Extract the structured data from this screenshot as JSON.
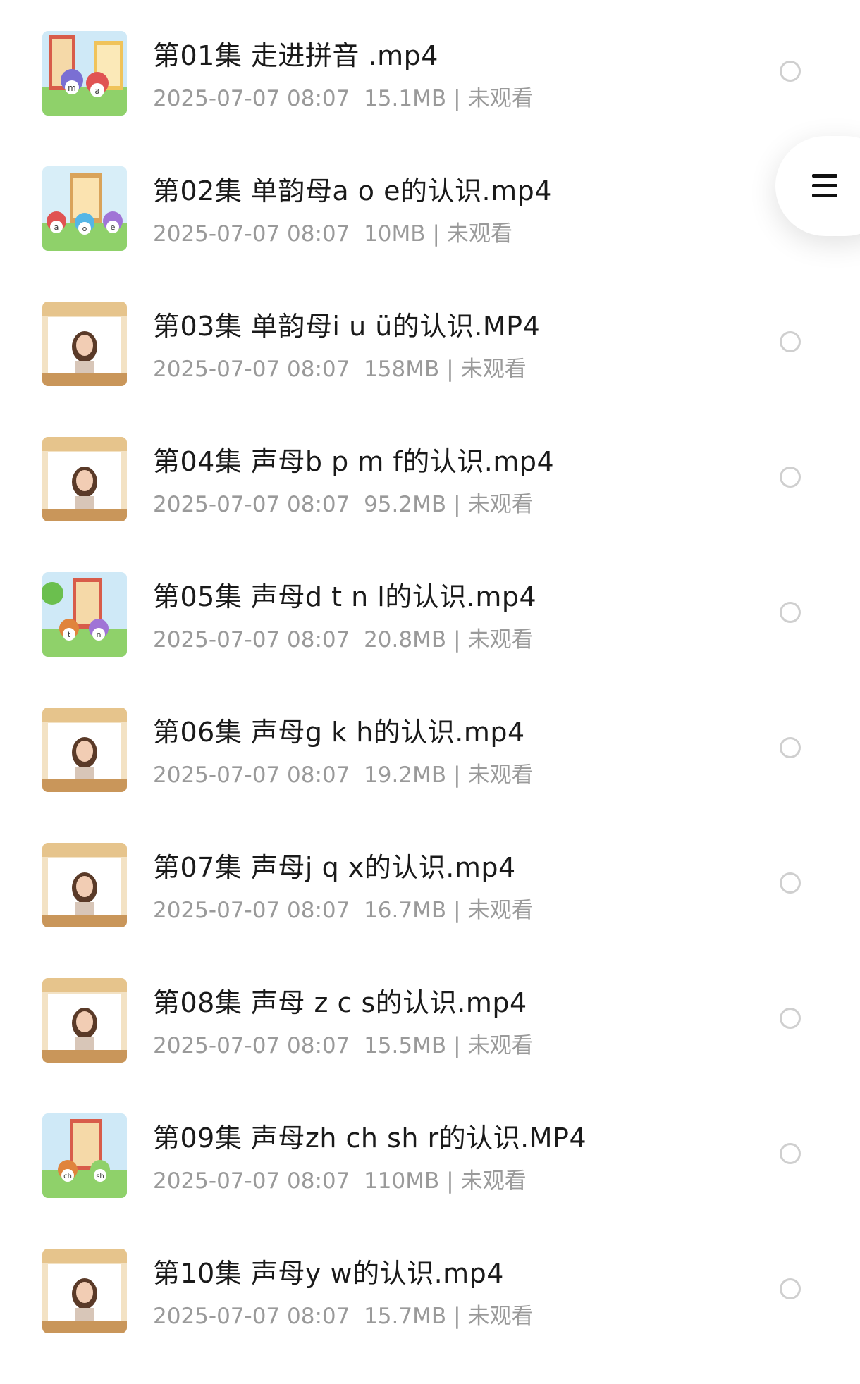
{
  "items": [
    {
      "title": "第01集 走进拼音 .mp4",
      "date": "2025-07-07 08:07",
      "size": "15.1MB",
      "status": "未观看",
      "thumb": "cartoon-m-a"
    },
    {
      "title": "第02集 单韵母a o e的认识.mp4",
      "date": "2025-07-07 08:07",
      "size": "10MB",
      "status": "未观看",
      "thumb": "cartoon-a-o-e"
    },
    {
      "title": "第03集 单韵母i u ü的认识.MP4",
      "date": "2025-07-07 08:07",
      "size": "158MB",
      "status": "未观看",
      "thumb": "presenter"
    },
    {
      "title": "第04集 声母b p m f的认识.mp4",
      "date": "2025-07-07 08:07",
      "size": "95.2MB",
      "status": "未观看",
      "thumb": "presenter"
    },
    {
      "title": "第05集 声母d t n l的认识.mp4",
      "date": "2025-07-07 08:07",
      "size": "20.8MB",
      "status": "未观看",
      "thumb": "cartoon-t-n"
    },
    {
      "title": "第06集 声母g k h的认识.mp4",
      "date": "2025-07-07 08:07",
      "size": "19.2MB",
      "status": "未观看",
      "thumb": "presenter"
    },
    {
      "title": "第07集 声母j q x的认识.mp4",
      "date": "2025-07-07 08:07",
      "size": "16.7MB",
      "status": "未观看",
      "thumb": "presenter"
    },
    {
      "title": "第08集 声母 z c s的认识.mp4",
      "date": "2025-07-07 08:07",
      "size": "15.5MB",
      "status": "未观看",
      "thumb": "presenter"
    },
    {
      "title": "第09集 声母zh ch sh r的认识.MP4",
      "date": "2025-07-07 08:07",
      "size": "110MB",
      "status": "未观看",
      "thumb": "cartoon-ch-sh"
    },
    {
      "title": "第10集 声母y w的认识.mp4",
      "date": "2025-07-07 08:07",
      "size": "15.7MB",
      "status": "未观看",
      "thumb": "presenter"
    }
  ],
  "separator": "|",
  "menu_button": {
    "icon": "hamburger-menu-icon"
  },
  "colors": {
    "title": "#1a1a1a",
    "meta": "#9a9a9a",
    "radio_border": "#cfcfcf"
  }
}
